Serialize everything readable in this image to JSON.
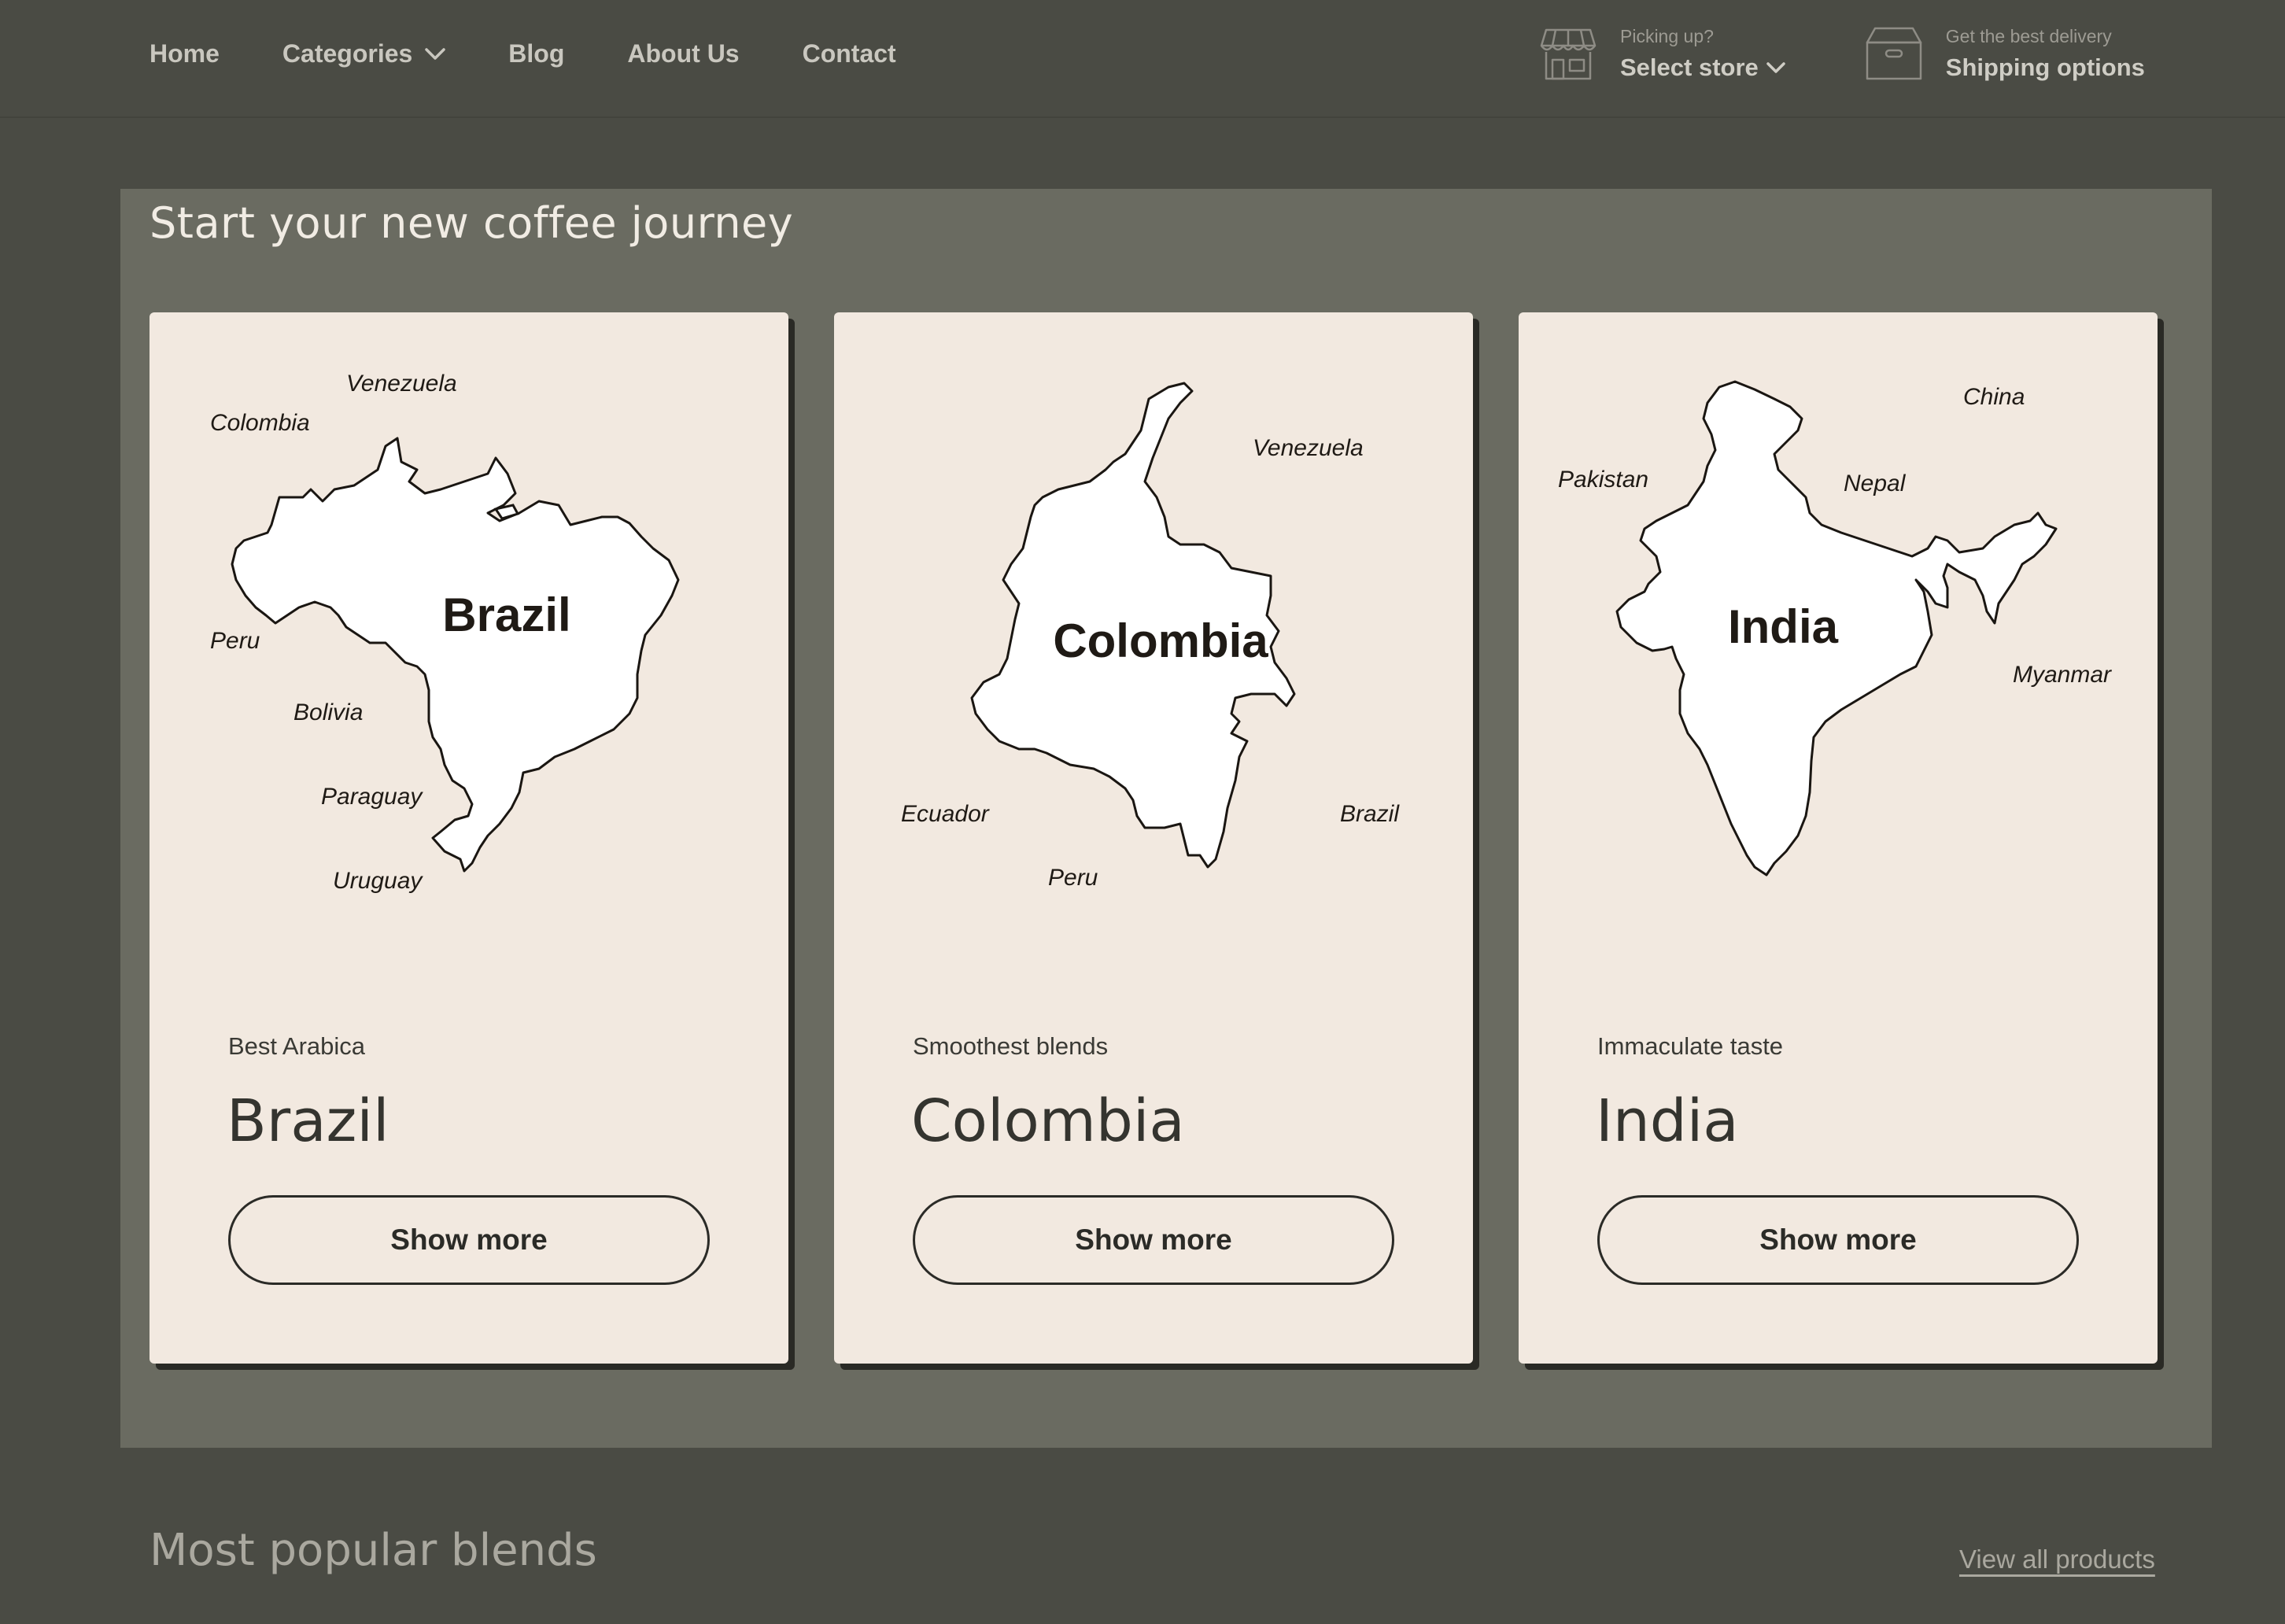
{
  "nav": {
    "links": [
      {
        "label": "Home"
      },
      {
        "label": "Categories"
      },
      {
        "label": "Blog"
      },
      {
        "label": "About Us"
      },
      {
        "label": "Contact"
      }
    ],
    "store": {
      "small": "Picking up?",
      "big": "Select store"
    },
    "shipping": {
      "small": "Get the best delivery",
      "big": "Shipping options"
    }
  },
  "hero": {
    "title": "Start your new coffee journey",
    "cards": [
      {
        "tag": "Best Arabica",
        "name": "Brazil",
        "button": "Show more",
        "map_title": "Brazil",
        "neighbors": [
          "Venezuela",
          "Colombia",
          "Peru",
          "Bolivia",
          "Paraguay",
          "Uruguay"
        ]
      },
      {
        "tag": "Smoothest blends",
        "name": "Colombia",
        "button": "Show more",
        "map_title": "Colombia",
        "neighbors": [
          "Venezuela",
          "Ecuador",
          "Brazil",
          "Peru"
        ]
      },
      {
        "tag": "Immaculate taste",
        "name": "India",
        "button": "Show more",
        "map_title": "India",
        "neighbors": [
          "China",
          "Pakistan",
          "Nepal",
          "Myanmar"
        ]
      }
    ]
  },
  "popular": {
    "title": "Most popular blends",
    "view_all": "View all products"
  },
  "icons": {
    "store": "store-icon",
    "shipping": "box-icon",
    "chevron": "chevron-down-icon"
  },
  "colors": {
    "page_bg": "#4a4b44",
    "section_bg": "#6a6b61",
    "card_bg": "#f2e9e0",
    "ink": "#2b2b27"
  }
}
